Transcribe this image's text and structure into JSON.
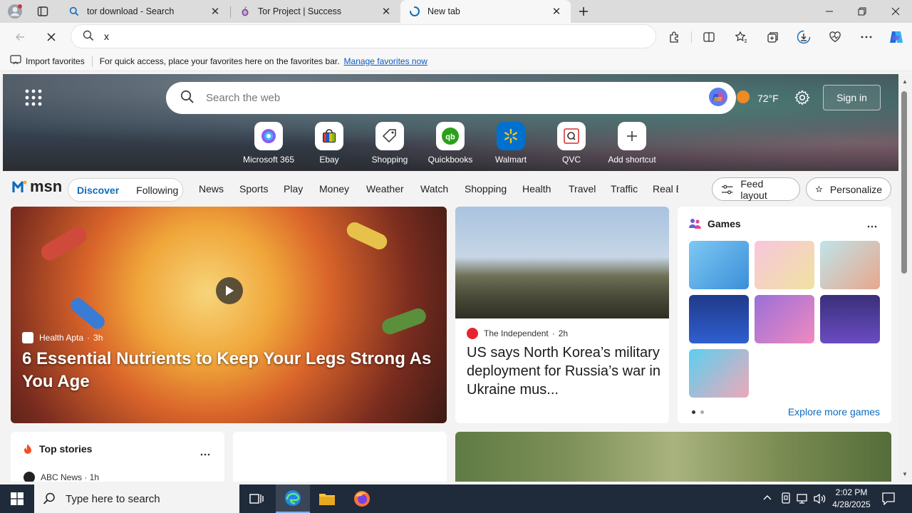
{
  "browser": {
    "tabs": [
      {
        "title": "tor download - Search",
        "favicon": "search-icon"
      },
      {
        "title": "Tor Project | Success",
        "favicon": "tor-onion-icon"
      },
      {
        "title": "New tab",
        "favicon": "loading-spinner-icon"
      }
    ],
    "address_value": "x",
    "favorites_bar": {
      "import_label": "Import favorites",
      "message": "For quick access, place your favorites here on the favorites bar.",
      "manage_link": "Manage favorites now"
    }
  },
  "newtab": {
    "search_placeholder": "Search the web",
    "weather": "72°F",
    "sign_in": "Sign in",
    "shortcuts": [
      {
        "label": "Microsoft 365",
        "icon": "microsoft365-icon"
      },
      {
        "label": "Ebay",
        "icon": "ebay-icon"
      },
      {
        "label": "Shopping",
        "icon": "shopping-tag-icon"
      },
      {
        "label": "Quickbooks",
        "icon": "quickbooks-icon"
      },
      {
        "label": "Walmart",
        "icon": "walmart-icon"
      },
      {
        "label": "QVC",
        "icon": "qvc-icon"
      },
      {
        "label": "Add shortcut",
        "icon": "plus-icon"
      }
    ],
    "msn_logo": "msn",
    "feed_toggle": {
      "active": "Discover",
      "inactive": "Following"
    },
    "categories": [
      "News",
      "Sports",
      "Play",
      "Money",
      "Weather",
      "Watch",
      "Shopping",
      "Health",
      "Travel",
      "Traffic",
      "Real E"
    ],
    "feed_layout": "Feed layout",
    "personalize": "Personalize",
    "main_story": {
      "source": "Health Apta",
      "age": "3h",
      "title": "6 Essential Nutrients to Keep Your Legs Strong As You Age"
    },
    "story2": {
      "source": "The Independent",
      "age": "2h",
      "title": "US says North Korea’s military deployment for Russia’s war in Ukraine mus..."
    },
    "games": {
      "title": "Games",
      "explore": "Explore more games"
    },
    "top_stories": {
      "title": "Top stories",
      "first_source": "ABC News · 1h"
    }
  },
  "taskbar": {
    "search_placeholder": "Type here to search",
    "time": "2:02 PM",
    "date": "4/28/2025"
  },
  "colors": {
    "accent": "#0f6cbd",
    "tabbar": "#dcdcdc",
    "taskbar": "#1f2a3a"
  }
}
